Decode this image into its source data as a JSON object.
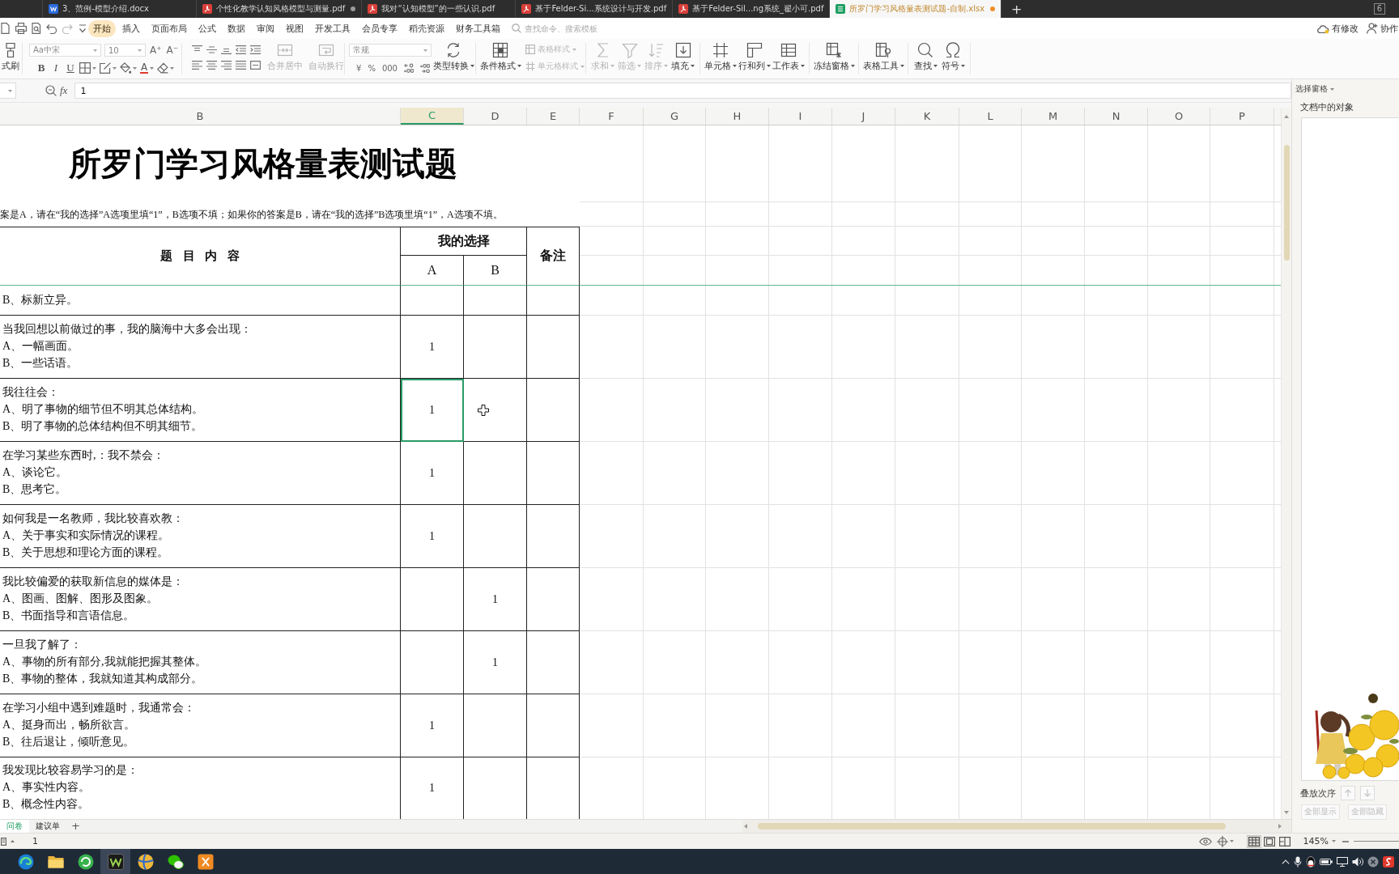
{
  "document_tabs": [
    {
      "label": "3、范例-模型介绍.docx",
      "kind": "word",
      "modified": false,
      "selected": false
    },
    {
      "label": "个性化教学认知风格模型与测量.pdf",
      "kind": "pdf",
      "modified": true,
      "selected": false
    },
    {
      "label": "我对“认知模型”的一些认识.pdf",
      "kind": "pdf",
      "modified": false,
      "selected": false
    },
    {
      "label": "基于Felder-Si...系统设计与开发.pdf",
      "kind": "pdf",
      "modified": false,
      "selected": false
    },
    {
      "label": "基于Felder-Sil...ng系统_翟小可.pdf",
      "kind": "pdf",
      "modified": false,
      "selected": false
    },
    {
      "label": "所罗门学习风格量表测试题-自制.xlsx",
      "kind": "sheet",
      "modified": true,
      "selected": true
    }
  ],
  "new_tab": "+",
  "tab_count": "6",
  "menu": {
    "items": [
      {
        "label": "开始",
        "selected": true
      },
      {
        "label": "插入",
        "selected": false
      },
      {
        "label": "页面布局",
        "selected": false
      },
      {
        "label": "公式",
        "selected": false
      },
      {
        "label": "数据",
        "selected": false
      },
      {
        "label": "审阅",
        "selected": false
      },
      {
        "label": "视图",
        "selected": false
      },
      {
        "label": "开发工具",
        "selected": false
      },
      {
        "label": "会员专享",
        "selected": false
      },
      {
        "label": "稻壳资源",
        "selected": false
      },
      {
        "label": "财务工具箱",
        "selected": false
      }
    ],
    "search": {
      "placeholder": "查找命令、搜索模板"
    },
    "sync_status": "有修改",
    "collaborate": "协作"
  },
  "ribbon": {
    "format_painter": "式刷",
    "font": {
      "name": "Aa中宋",
      "size": "10",
      "grow": "A⁺",
      "shrink": "A⁻",
      "styles": [
        {
          "label": "B",
          "kind": "bold"
        },
        {
          "label": "I",
          "kind": "italic"
        },
        {
          "label": "U",
          "kind": "underline"
        }
      ],
      "foreground": "A"
    },
    "merge": {
      "label": "合并居中",
      "disabled": true
    },
    "wrap": {
      "label": "自动换行",
      "disabled": true
    },
    "number_format": "常规",
    "number_symbols": [
      "¥",
      "%",
      "000"
    ],
    "type_convert": {
      "label": "类型转换",
      "dropdown": true
    },
    "styles": [
      {
        "label": "条件格式",
        "kind": "conditional",
        "disabled": false,
        "dropdown": true
      },
      {
        "label": "表格样式",
        "kind": "table-style",
        "disabled": true,
        "dropdown": true
      },
      {
        "label": "单元格样式",
        "kind": "cell-style",
        "disabled": true,
        "dropdown": true
      }
    ],
    "tools": [
      {
        "label": "求和",
        "kind": "sum",
        "disabled": true,
        "dropdown": true
      },
      {
        "label": "筛选",
        "kind": "filter",
        "disabled": true,
        "dropdown": true
      },
      {
        "label": "排序",
        "kind": "sort",
        "disabled": true,
        "dropdown": true
      },
      {
        "label": "填充",
        "kind": "fill",
        "disabled": false,
        "dropdown": true
      },
      {
        "label": "单元格",
        "kind": "cell",
        "disabled": false,
        "dropdown": true
      },
      {
        "label": "行和列",
        "kind": "rows",
        "disabled": false,
        "dropdown": true
      },
      {
        "label": "工作表",
        "kind": "sheet",
        "disabled": false,
        "dropdown": true
      },
      {
        "label": "冻结窗格",
        "kind": "freeze",
        "disabled": false,
        "dropdown": true
      },
      {
        "label": "表格工具",
        "kind": "tools",
        "disabled": false,
        "dropdown": true
      },
      {
        "label": "查找",
        "kind": "find",
        "disabled": false,
        "dropdown": true
      },
      {
        "label": "符号",
        "kind": "symbol",
        "disabled": false,
        "dropdown": true
      }
    ]
  },
  "formula_bar": {
    "fx": "fx",
    "content": "1"
  },
  "column_headers": [
    {
      "label": "B",
      "selected": false
    },
    {
      "label": "C",
      "selected": true
    },
    {
      "label": "D",
      "selected": false
    },
    {
      "label": "E",
      "selected": false
    },
    {
      "label": "F",
      "selected": false
    },
    {
      "label": "G",
      "selected": false
    },
    {
      "label": "H",
      "selected": false
    },
    {
      "label": "I",
      "selected": false
    },
    {
      "label": "J",
      "selected": false
    },
    {
      "label": "K",
      "selected": false
    },
    {
      "label": "L",
      "selected": false
    },
    {
      "label": "M",
      "selected": false
    },
    {
      "label": "N",
      "selected": false
    },
    {
      "label": "O",
      "selected": false
    },
    {
      "label": "P",
      "selected": false
    }
  ],
  "sheet": {
    "title": "所罗门学习风格量表测试题",
    "instruction": "案是A，请在“我的选择”A选项里填“1”，B选项不填；如果你的答案是B，请在“我的选择”B选项里填“1”，A选项不填。",
    "header": {
      "question": "题 目 内 容",
      "choice": "我的选择",
      "options": [
        "A",
        "B"
      ],
      "notes": "备注"
    },
    "rows": [
      {
        "option_b": "B、标新立异。",
        "cells": [
          {
            "selected": false
          },
          {
            "selected": false
          },
          {
            "selected": false
          }
        ]
      },
      {
        "question": "当我回想以前做过的事，我的脑海中大多会出现：",
        "option_a": "A、一幅画面。",
        "option_b": "B、一些话语。",
        "cells": [
          {
            "value": "1",
            "selected": false
          },
          {
            "selected": false
          },
          {
            "selected": false
          }
        ]
      },
      {
        "question": "我往往会：",
        "option_a": "A、明了事物的细节但不明其总体结构。",
        "option_b": "B、明了事物的总体结构但不明其细节。",
        "cells": [
          {
            "value": "1",
            "selected": true
          },
          {
            "selected": false,
            "cursor": true
          },
          {
            "selected": false
          }
        ]
      },
      {
        "question": "在学习某些东西时,：我不禁会：",
        "option_a": "A、谈论它。",
        "option_b": "B、思考它。",
        "cells": [
          {
            "value": "1",
            "selected": false
          },
          {
            "selected": false
          },
          {
            "selected": false
          }
        ]
      },
      {
        "question": "如何我是一名教师，我比较喜欢教：",
        "option_a": "A、关于事实和实际情况的课程。",
        "option_b": "B、关于思想和理论方面的课程。",
        "cells": [
          {
            "value": "1",
            "selected": false
          },
          {
            "selected": false
          },
          {
            "selected": false
          }
        ]
      },
      {
        "question": "我比较偏爱的获取新信息的媒体是：",
        "option_a": "A、图画、图解、图形及图象。",
        "option_b": "B、书面指导和言语信息。",
        "cells": [
          {
            "selected": false
          },
          {
            "value": "1",
            "selected": false
          },
          {
            "selected": false
          }
        ]
      },
      {
        "question": "一旦我了解了：",
        "option_a": "A、事物的所有部分,我就能把握其整体。",
        "option_b": "B、事物的整体，我就知道其构成部分。",
        "cells": [
          {
            "selected": false
          },
          {
            "value": "1",
            "selected": false
          },
          {
            "selected": false
          }
        ]
      },
      {
        "question": "在学习小组中遇到难题时，我通常会：",
        "option_a": "A、挺身而出，畅所欲言。",
        "option_b": "B、往后退让，倾听意见。",
        "cells": [
          {
            "value": "1",
            "selected": false
          },
          {
            "selected": false
          },
          {
            "selected": false
          }
        ]
      },
      {
        "question": "我发现比较容易学习的是：",
        "option_a": "A、事实性内容。",
        "option_b": "B、概念性内容。",
        "cells": [
          {
            "value": "1",
            "selected": false
          },
          {
            "selected": false
          },
          {
            "selected": false
          }
        ]
      }
    ]
  },
  "sheet_tabs": [
    {
      "label": "问卷",
      "selected": true
    },
    {
      "label": "建议单",
      "selected": false
    }
  ],
  "add_sheet": "+",
  "selection_pane": {
    "title": "选择窗格",
    "objects_label": "文档中的对象",
    "order_label": "叠放次序",
    "order_buttons": [
      {
        "kind": "up",
        "disabled": true
      },
      {
        "kind": "down",
        "disabled": true
      }
    ],
    "actions": [
      {
        "label": "全部显示",
        "disabled": true
      },
      {
        "label": "全部隐藏",
        "disabled": true
      }
    ]
  },
  "status_bar": {
    "value": "1",
    "zoom": "145%",
    "views": [
      {
        "kind": "normal",
        "selected": true
      },
      {
        "kind": "page",
        "selected": false
      },
      {
        "kind": "preview",
        "selected": false
      }
    ]
  },
  "taskbar": {
    "apps": [
      {
        "kind": "browser",
        "selected": false
      },
      {
        "kind": "folder",
        "selected": false
      },
      {
        "kind": "swirl",
        "selected": false
      },
      {
        "kind": "tile",
        "selected": true
      },
      {
        "kind": "ball",
        "selected": false
      },
      {
        "kind": "chat",
        "selected": false
      },
      {
        "kind": "tool",
        "selected": false
      }
    ]
  }
}
